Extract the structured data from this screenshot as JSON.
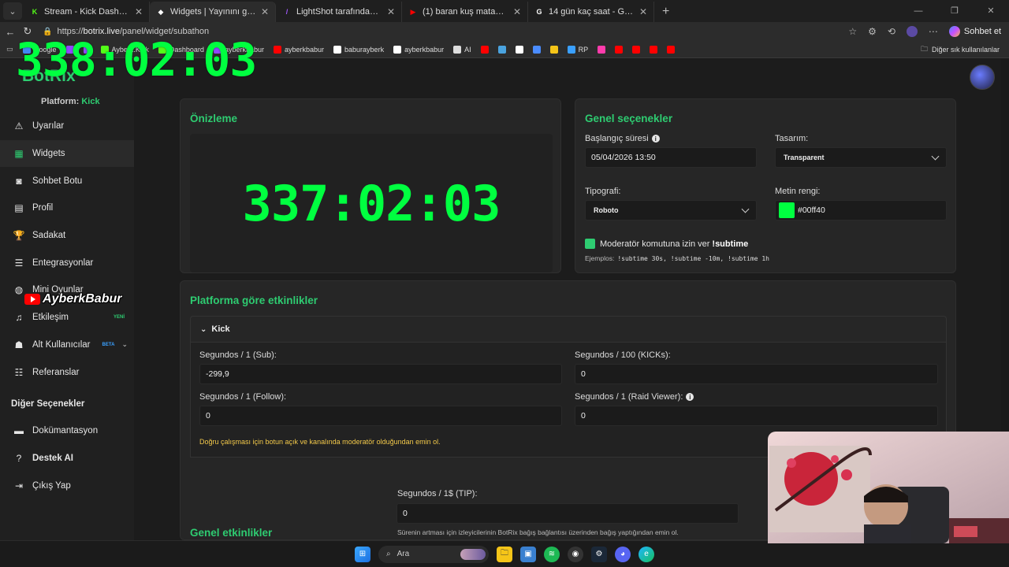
{
  "browser": {
    "tabs": [
      {
        "label": "Stream - Kick Dashboard",
        "fav_color": "#53fc18",
        "fav_char": "K"
      },
      {
        "label": "Widgets | Yayınını güçlendirmek iç",
        "fav_color": "#ffffff",
        "fav_char": "◆"
      },
      {
        "label": "LightShot tarafından Ekran Görün",
        "fav_color": "#a259ff",
        "fav_char": "/"
      },
      {
        "label": "(1) baran kuş matador - YouTube",
        "fav_color": "#ff0000",
        "fav_char": "▶"
      },
      {
        "label": "14 gün kaç saat - Google'da Ara",
        "fav_color": "#ffffff",
        "fav_char": "G"
      }
    ],
    "url_prefix": "https://",
    "url_host": "botrix.live",
    "url_path": "/panel/widget/subathon",
    "chat_button": "Sohbet et",
    "bookmarks": [
      {
        "label": "Google",
        "color": "#4285f4"
      },
      {
        "label": "",
        "color": "#9146ff"
      },
      {
        "label": "",
        "color": "#9146ff"
      },
      {
        "label": "Ayberk.Kick",
        "color": "#53fc18"
      },
      {
        "label": "Dashboard",
        "color": "#53fc18"
      },
      {
        "label": "ayberkbabur",
        "color": "#9146ff"
      },
      {
        "label": "ayberkbabur",
        "color": "#ff0000"
      },
      {
        "label": "baburayberk",
        "color": "#ffffff"
      },
      {
        "label": "ayberkbabur",
        "color": "#ffffff"
      },
      {
        "label": "AI",
        "color": "#dddddd"
      },
      {
        "label": "",
        "color": "#ff0000"
      },
      {
        "label": "",
        "color": "#4aa3df"
      },
      {
        "label": "",
        "color": "#ffffff"
      },
      {
        "label": "",
        "color": "#4a8cff"
      },
      {
        "label": "",
        "color": "#f5c518"
      },
      {
        "label": "RP",
        "color": "#3aa0ff"
      },
      {
        "label": "",
        "color": "#ff3cac"
      },
      {
        "label": "",
        "color": "#ff0000"
      },
      {
        "label": "",
        "color": "#ff0000"
      },
      {
        "label": "",
        "color": "#ff0000"
      },
      {
        "label": "",
        "color": "#ff0000"
      }
    ],
    "other_bookmarks": "Diğer sık kullanılanlar"
  },
  "overlay_timer": "338:02:03",
  "sidebar": {
    "brand": "BotRix",
    "platform_label": "Platform:",
    "platform_value": "Kick",
    "items": [
      {
        "label": "Uyarılar",
        "icon": "warning-icon"
      },
      {
        "label": "Widgets",
        "icon": "grid-icon"
      },
      {
        "label": "Sohbet Botu",
        "icon": "robot-icon"
      },
      {
        "label": "Profil",
        "icon": "id-card-icon"
      },
      {
        "label": "Sadakat",
        "icon": "trophy-icon"
      },
      {
        "label": "Entegrasyonlar",
        "icon": "plug-icon"
      },
      {
        "label": "Mini Oyunlar",
        "icon": "gamepad-icon"
      },
      {
        "label": "Etkileşim",
        "icon": "music-icon",
        "tag": "YENİ"
      },
      {
        "label": "Alt Kullanıcılar",
        "icon": "users-icon",
        "tag": "BETA"
      },
      {
        "label": "Referanslar",
        "icon": "referral-icon"
      }
    ],
    "other_heading": "Diğer Seçenekler",
    "other_items": [
      {
        "label": "Dokümantasyon",
        "icon": "docs-icon"
      },
      {
        "label": "Destek AI",
        "icon": "help-icon"
      },
      {
        "label": "Çıkış Yap",
        "icon": "logout-icon"
      }
    ],
    "channel_logo_text": "AyberkBabur"
  },
  "preview": {
    "title": "Önizleme",
    "timer": "337:02:03"
  },
  "general": {
    "title": "Genel seçenekler",
    "start_label": "Başlangıç süresi",
    "start_value": "05/04/2026 13:50",
    "design_label": "Tasarım:",
    "design_value": "Transparent",
    "typography_label": "Tipografi:",
    "typography_value": "Roboto",
    "text_color_label": "Metin rengi:",
    "text_color_value": "#00ff40",
    "mod_label": "Moderatör komutuna izin ver",
    "mod_command": "!subtime",
    "examples_label": "Ejemplos:",
    "examples": "!subtime 30s, !subtime -10m, !subtime 1h"
  },
  "platform_events": {
    "title": "Platforma göre etkinlikler",
    "accordion": "Kick",
    "fields": [
      {
        "label": "Segundos / 1 (Sub):",
        "value": "-299,9"
      },
      {
        "label": "Segundos / 100 (KICKs):",
        "value": "0"
      },
      {
        "label": "Segundos / 1 (Follow):",
        "value": "0"
      },
      {
        "label": "Segundos / 1 (Raid Viewer):",
        "value": "0"
      }
    ],
    "warning": "Doğru çalışması için botun açık ve kanalında moderatör olduğundan emin ol."
  },
  "general_events": {
    "title": "Genel etkinlikler",
    "tip_label": "Segundos / 1$ (TIP):",
    "tip_value": "0",
    "note": "Sürenin artması için izleyicilerinin BotRix bağış bağlantısı üzerinden bağış yaptığından emin ol."
  },
  "taskbar": {
    "search": "Ara"
  }
}
